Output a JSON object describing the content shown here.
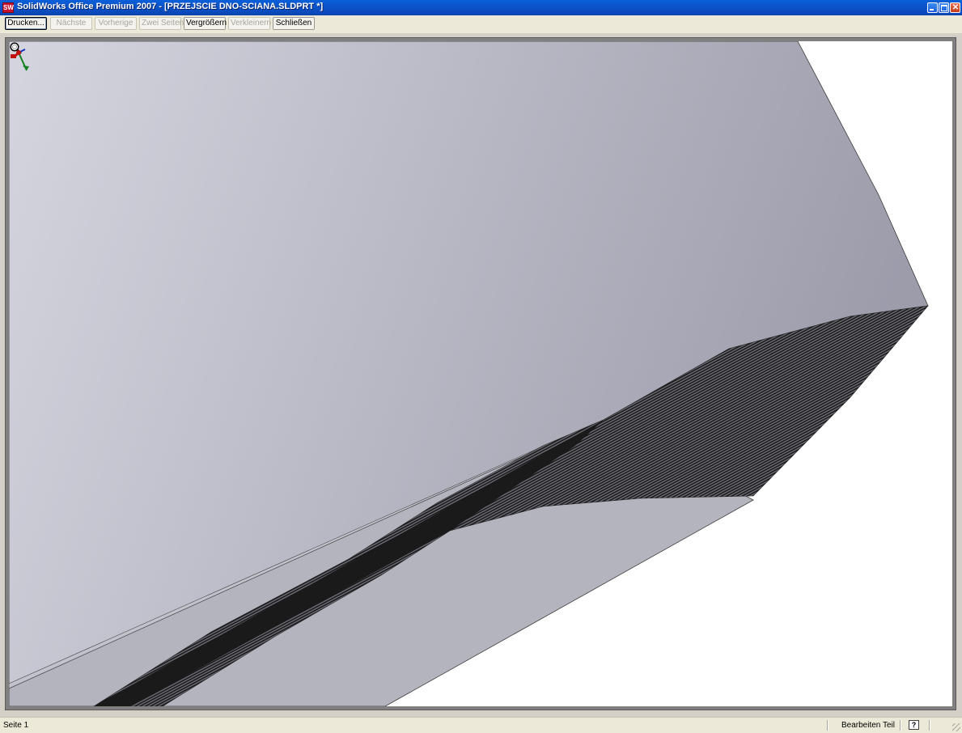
{
  "window": {
    "title": "SolidWorks Office Premium 2007 - [PRZEJSCIE DNO-SCIANA.SLDPRT *]",
    "icon": "solidworks-logo-icon",
    "app_icon_text": "SW",
    "close_glyph": "✕"
  },
  "toolbar": {
    "print_label": "Drucken...",
    "next_label": "Nächste",
    "previous_label": "Vorherige",
    "two_pages_label": "Zwei Seiten",
    "zoom_in_label": "Vergrößern",
    "zoom_out_label": "Verkleinern",
    "close_label": "Schließen"
  },
  "preview": {
    "cursor_icon": "magnifier-icon",
    "triad_icon": "coordinate-triad-icon",
    "face_colors": {
      "top_light": "#d5d5df",
      "top_dark": "#9c9cab",
      "bottom": "#b4b4bf",
      "mesh": "#1a1a1a"
    }
  },
  "status": {
    "page_label": "Seite 1",
    "mode_label": "Bearbeiten Teil",
    "help_icon": "help-icon",
    "help_glyph": "?"
  }
}
